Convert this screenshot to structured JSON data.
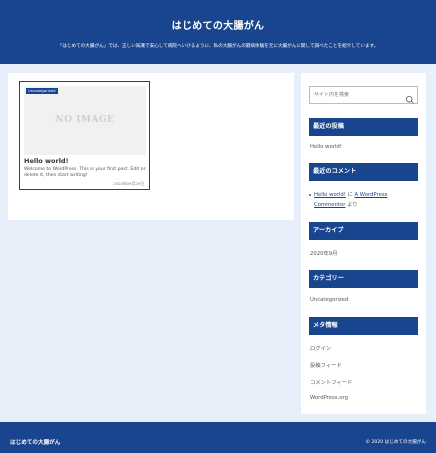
{
  "header": {
    "site_title": "はじめての大腸がん",
    "description": "「はじめての大腸がん」では、正しい知識で安心して病院へいけるように、私の大腸がんの闘病体験を元に大腸がんに関して調べたことを紹介しています。"
  },
  "posts": [
    {
      "category": "Uncategorized",
      "thumbnail_text": "NO IMAGE",
      "title": "Hello world!",
      "excerpt": "Welcome to WordPress. This is your first post. Edit or delete it, then start writing!",
      "date": "2020年09月29日"
    }
  ],
  "sidebar": {
    "search_placeholder": "サイト内を検索",
    "recent_posts": {
      "title": "最近の投稿",
      "items": [
        "Hello world!"
      ]
    },
    "recent_comments": {
      "title": "最近のコメント",
      "post": "Hello world!",
      "connector": " に ",
      "author": "A WordPress Commenter",
      "suffix": " より"
    },
    "archives": {
      "title": "アーカイブ",
      "items": [
        "2020年9月"
      ]
    },
    "categories": {
      "title": "カテゴリー",
      "items": [
        "Uncategorized"
      ]
    },
    "meta": {
      "title": "メタ情報",
      "items": [
        "ログイン",
        "投稿フィード",
        "コメントフィード",
        "WordPress.org"
      ]
    }
  },
  "footer": {
    "site_title": "はじめての大腸がん",
    "copyright": "© 2020 はじめての大腸がん"
  },
  "colors": {
    "primary": "#19448e",
    "background": "#e6effa"
  }
}
